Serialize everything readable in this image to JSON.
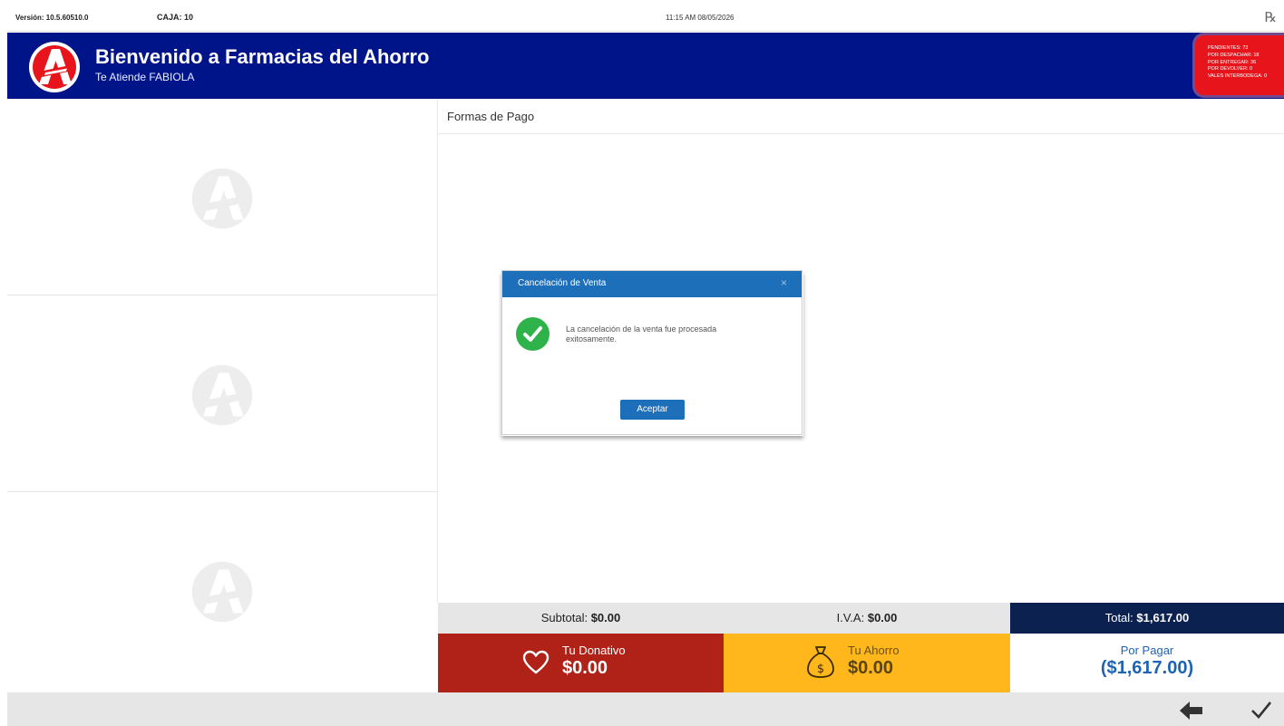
{
  "topbar": {
    "version": "Versión: 10.5.60510.0",
    "caja": "CAJA: 10",
    "datetime": "11:15 AM 08/05/2026",
    "rx_label": "℞"
  },
  "header": {
    "title": "Bienvenido a Farmacias del Ahorro",
    "attendant": "Te Atiende FABIOLA",
    "status": {
      "pendientes": "PENDIENTES: 73",
      "por_despachar": "POR DESPACHAR: 18",
      "por_entregar": "POR ENTREGAR: 36",
      "por_devolver": "POR DEVOLVER: 0",
      "vales": "VALES INTERBODEGA: 0"
    }
  },
  "main": {
    "section_title": "Formas de Pago"
  },
  "totals": {
    "subtotal_label": "Subtotal:",
    "subtotal_value": "$0.00",
    "iva_label": "I.V.A:",
    "iva_value": "$0.00",
    "total_label": "Total:",
    "total_value": "$1,617.00"
  },
  "payment": {
    "donativo_label": "Tu Donativo",
    "donativo_value": "$0.00",
    "ahorro_label": "Tu Ahorro",
    "ahorro_value": "$0.00",
    "por_pagar_label": "Por Pagar",
    "por_pagar_value": "($1,617.00)"
  },
  "modal": {
    "title": "Cancelación de Venta",
    "close": "×",
    "message": "La cancelación de la venta fue procesada exitosamente.",
    "button": "Aceptar"
  },
  "icons": [
    "logo-icon",
    "rx-icon",
    "heart-icon",
    "money-bag-icon",
    "back-arrow-icon",
    "check-icon",
    "success-icon",
    "close-icon"
  ],
  "colors": {
    "header_blue": "#001489",
    "badge_red": "#e8141c",
    "total_navy": "#0b2150",
    "donativo_red": "#b02118",
    "ahorro_yellow": "#ffb71b",
    "por_pagar_blue": "#1e64b4",
    "modal_blue": "#1e6fba",
    "success_green": "#2db34a"
  }
}
